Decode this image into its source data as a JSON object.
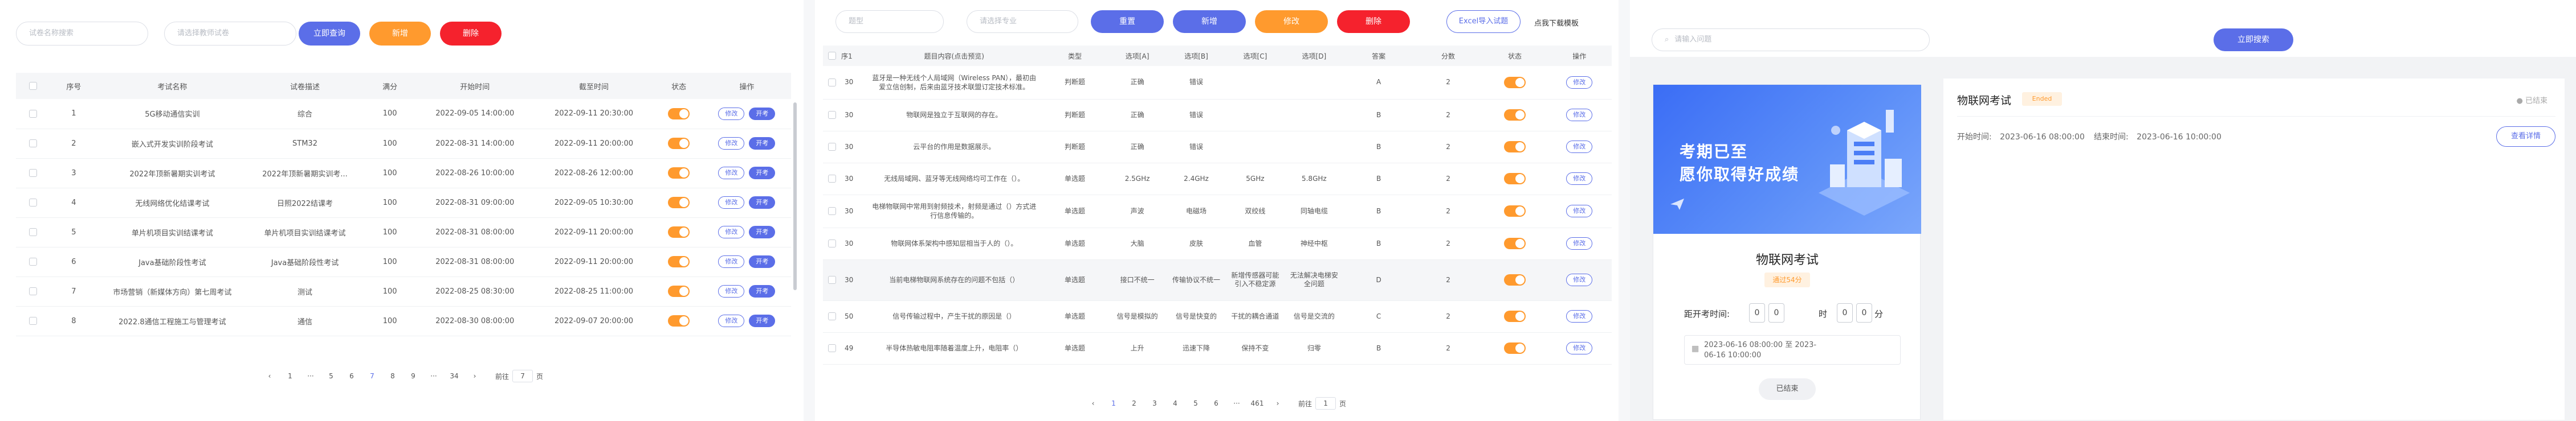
{
  "panel1": {
    "search1": "试卷名称搜索",
    "search2": "请选择教师试卷",
    "btn_query": "立即查询",
    "btn_add": "新增",
    "btn_delete": "删除",
    "headers": [
      "序号",
      "考试名称",
      "试卷描述",
      "满分",
      "开始时间",
      "截至时间",
      "状态",
      "操作"
    ],
    "rows": [
      [
        "1",
        "5G移动通信实训",
        "综合",
        "100",
        "2022-09-05 14:00:00",
        "2022-09-11 20:30:00"
      ],
      [
        "2",
        "嵌入式开发实训阶段考试",
        "STM32",
        "100",
        "2022-08-31 14:00:00",
        "2022-09-11 20:00:00"
      ],
      [
        "3",
        "2022年顶新暑期实训考试",
        "2022年顶新暑期实训考...",
        "100",
        "2022-08-26 10:00:00",
        "2022-08-26 12:00:00"
      ],
      [
        "4",
        "无线网络优化结课考试",
        "日照2022结课考",
        "100",
        "2022-08-31 09:00:00",
        "2022-09-05 10:30:00"
      ],
      [
        "5",
        "单片机项目实训结课考试",
        "单片机项目实训结课考试",
        "100",
        "2022-08-31 08:00:00",
        "2022-09-11 20:00:00"
      ],
      [
        "6",
        "Java基础阶段性考试",
        "Java基础阶段性考试",
        "100",
        "2022-08-31 08:00:00",
        "2022-09-11 20:00:00"
      ],
      [
        "7",
        "市场营销（新媒体方向）第七周考试",
        "测试",
        "100",
        "2022-08-25 08:30:00",
        "2022-08-25 11:00:00"
      ],
      [
        "8",
        "2022.8通信工程施工与管理考试",
        "通信",
        "100",
        "2022-08-30 08:00:00",
        "2022-09-07 20:00:00"
      ]
    ],
    "edit": "修改",
    "exam": "开考",
    "pages": [
      "‹",
      "1",
      "···",
      "5",
      "6",
      "7",
      "8",
      "9",
      "···",
      "34",
      "›"
    ],
    "goto": "前往",
    "goto_val": "7",
    "page_unit": "页"
  },
  "panel2": {
    "select1": "题型",
    "select2": "请选择专业",
    "btn_reset": "重置",
    "btn_add": "新增",
    "btn_edit": "修改",
    "btn_delete": "删除",
    "btn_import": "Excel导入试题",
    "link_template": "点我下载模板",
    "headers": [
      "序1",
      "题目内容(点击预览)",
      "类型",
      "选项[A]",
      "选项[B]",
      "选项[C]",
      "选项[D]",
      "答案",
      "分数",
      "状态",
      "操作"
    ],
    "rows": [
      [
        "30",
        "蓝牙是一种无线个人局域网（Wireless PAN），最初由爱立信创制，后来由蓝牙技术联盟订定技术标准。",
        "判断题",
        "正确",
        "错误",
        "",
        "",
        "A",
        "2"
      ],
      [
        "30",
        "物联网是独立于互联网的存在。",
        "判断题",
        "正确",
        "错误",
        "",
        "",
        "B",
        "2"
      ],
      [
        "30",
        "云平台的作用是数据展示。",
        "判断题",
        "正确",
        "错误",
        "",
        "",
        "B",
        "2"
      ],
      [
        "30",
        "无线局域网、蓝牙等无线网络均可工作在（）。",
        "单选题",
        "2.5GHz",
        "2.4GHz",
        "5GHz",
        "5.8GHz",
        "B",
        "2"
      ],
      [
        "30",
        "电梯物联网中常用到射频技术，射频是通过（）方式进行信息传输的。",
        "单选题",
        "声波",
        "电磁场",
        "双绞线",
        "同轴电缆",
        "B",
        "2"
      ],
      [
        "30",
        "物联网体系架构中感知层相当于人的（）。",
        "单选题",
        "大脑",
        "皮肤",
        "血管",
        "神经中枢",
        "B",
        "2"
      ],
      [
        "30",
        "当前电梯物联网系统存在的问题不包括（）",
        "单选题",
        "接口不统一",
        "传输协议不统一",
        "新增传感器可能引入不稳定源",
        "无法解决电梯安全问题",
        "D",
        "2"
      ],
      [
        "50",
        "信号传输过程中，产生干扰的原因是（）",
        "单选题",
        "信号是模拟的",
        "信号是快变的",
        "干扰的耦合通道",
        "信号是交流的",
        "C",
        "2"
      ],
      [
        "49",
        "半导体热敏电阻率随着温度上升，电阻率（）",
        "单选题",
        "上升",
        "迅速下降",
        "保持不变",
        "归零",
        "B",
        "2"
      ]
    ],
    "edit": "修改",
    "pages": [
      "‹",
      "1",
      "2",
      "3",
      "4",
      "5",
      "6",
      "···",
      "461",
      "›"
    ],
    "goto": "前往",
    "goto_val": "1",
    "page_unit": "页"
  },
  "panel3": {
    "search": "请输入问题",
    "btn_search": "立即搜索",
    "banner_line1": "考期已至",
    "banner_line2": "愿你取得好成绩",
    "exam_title": "物联网考试",
    "exam_tag": "通过54分",
    "countdown_label": "距开考时间:",
    "countdown_d": [
      "0",
      "0"
    ],
    "hour": "时",
    "minute": "分",
    "countdown_m": [
      "0",
      "0"
    ],
    "date_range": "2023-06-16 08:00:00  至  2023-06-16 10:00:00",
    "btn_ended": "已结束",
    "list_title": "物联网考试",
    "list_tag": "Ended",
    "list_status": "已结束",
    "start_label": "开始时间:",
    "start_val": "2023-06-16 08:00:00",
    "end_label": "结束时间:",
    "end_val": "2023-06-16 10:00:00",
    "btn_detail": "查看详情"
  },
  "colors": {
    "accent": "#5b6ee8",
    "orange": "#ff9a2e",
    "red": "#f5222d"
  }
}
